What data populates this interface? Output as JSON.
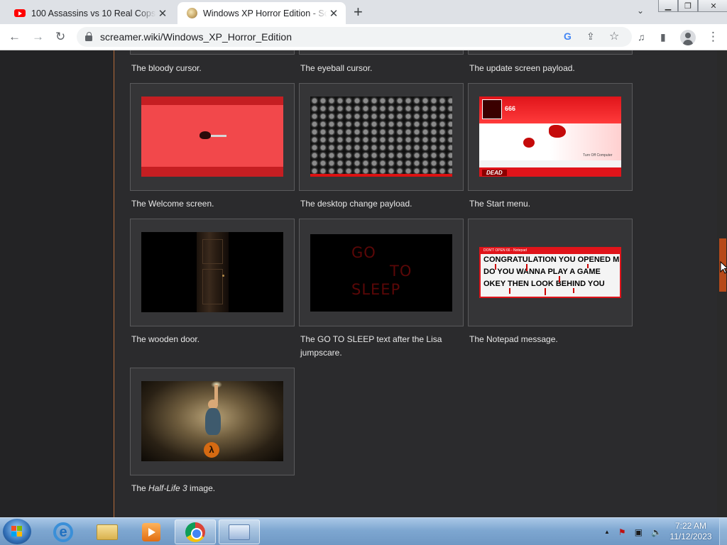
{
  "browser": {
    "tabs": [
      {
        "title": "100 Assassins vs 10 Real Cops! - YouTube",
        "favicon": "youtube-icon",
        "active": false
      },
      {
        "title": "Windows XP Horror Edition - Screamer Wiki",
        "favicon": "wiki-icon",
        "active": true
      }
    ],
    "close_glyph": "✕",
    "new_tab_glyph": "+",
    "tab_search_glyph": "⌄",
    "window_controls": {
      "minimize": "▁",
      "maximize": "❐",
      "close": "✕"
    },
    "nav": {
      "back": "←",
      "forward": "→",
      "reload": "↻"
    },
    "url": "screamer.wiki/Windows_XP_Horror_Edition",
    "omnibox_icons": {
      "google": "G",
      "share": "⇪",
      "bookmark": "☆"
    },
    "toolbar_icons": {
      "media": "♫",
      "sidepanel": "▮",
      "menu": "⋮"
    }
  },
  "gallery": {
    "top_captions": [
      "The bloody cursor.",
      "The eyeball cursor.",
      "The update screen payload."
    ],
    "row1": [
      "The Welcome screen.",
      "The desktop change payload.",
      "The Start menu."
    ],
    "row2": [
      "The wooden door.",
      "The GO TO SLEEP text after the Lisa jumpscare.",
      "The Notepad message."
    ],
    "row3": {
      "prefix": "The ",
      "italic": "Half-Life 3",
      "suffix": " image."
    },
    "start_menu_img": {
      "user": "666",
      "dead": "DEAD",
      "turn_off": "Turn Off Computer"
    },
    "sleep_text": {
      "line1a": "GO",
      "line1b": "TO",
      "line2": "SLEEP"
    },
    "notepad": {
      "title": "DON'T OPEN 66 - Notepad",
      "lines": [
        "CONGRATULATION YOU OPENED ME",
        "DO YOU WANNA PLAY A GAME",
        "OKEY THEN LOOK BEHIND YOU"
      ]
    },
    "hl3_logo": "λ"
  },
  "taskbar": {
    "clock_time": "7:22 AM",
    "clock_date": "11/12/2023",
    "tray_icons": [
      "show-hidden-icons-icon",
      "action-center-icon",
      "network-icon",
      "volume-muted-icon"
    ],
    "tray_glyphs": {
      "up": "▲",
      "flag": "⚑",
      "network": "▣",
      "volume": "🔈"
    }
  }
}
